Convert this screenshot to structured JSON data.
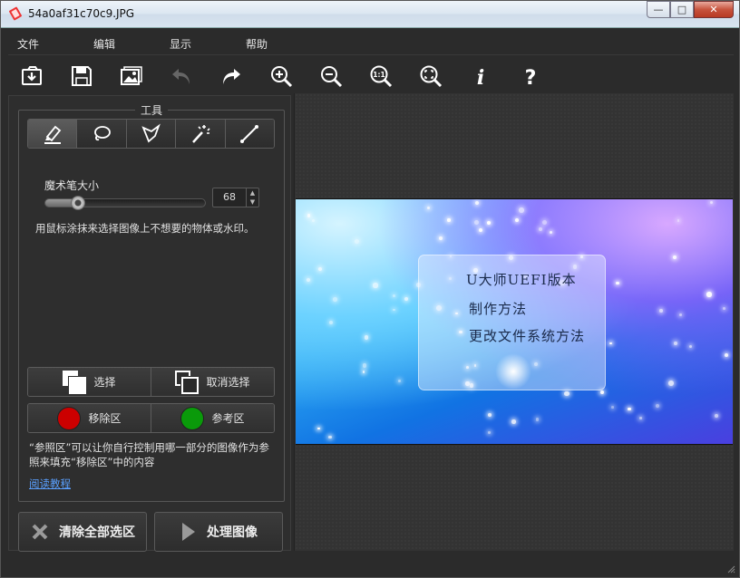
{
  "window": {
    "title": "54a0af31c70c9.JPG",
    "buttons": [
      "—",
      "□",
      "✕"
    ]
  },
  "menu": [
    "文件",
    "编辑",
    "显示",
    "帮助"
  ],
  "toolbar": [
    "open-icon",
    "save-icon",
    "image-icon",
    "undo-icon",
    "redo-icon",
    "zoom-in-icon",
    "zoom-out-icon",
    "zoom-actual-icon",
    "fit-screen-icon",
    "info-icon",
    "help-icon"
  ],
  "tools": {
    "title": "工具",
    "items": [
      "marker-icon",
      "lasso-icon",
      "polygon-lasso-icon",
      "magic-wand-icon",
      "line-icon"
    ],
    "brush_label": "魔术笔大小",
    "brush_size": "68",
    "brush_fraction": 0.2,
    "hint": "用鼠标涂抹来选择图像上不想要的物体或水印。",
    "select_label": "选择",
    "deselect_label": "取消选择",
    "remove_label": "移除区",
    "reference_label": "参考区",
    "remove_color": "#cc0000",
    "reference_color": "#0a9a0a"
  },
  "reference_note": "“参照区”可以让你自行控制用哪一部分的图像作为参照来填充“移除区”中的内容",
  "tutorial_link": "阅读教程",
  "actions": {
    "clear_label": "清除全部选区",
    "process_label": "处理图像"
  },
  "photo": {
    "lines": [
      "U大师UEFI版本",
      "制作方法",
      "更改文件系统方法"
    ]
  }
}
